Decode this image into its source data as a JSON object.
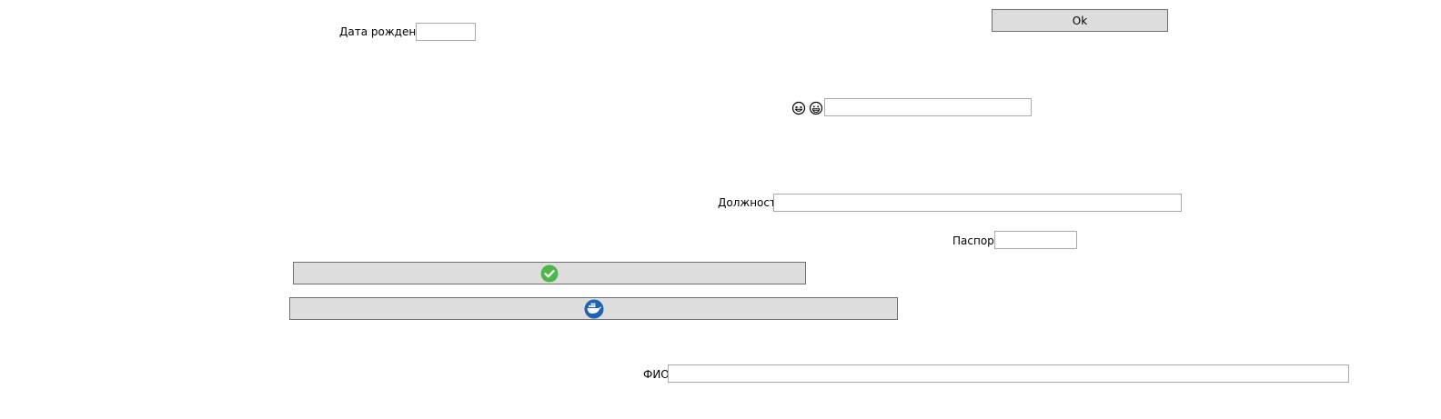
{
  "form": {
    "birth_date_label": "Дата рождения",
    "birth_date_value": "",
    "ok_button_label": "Ok",
    "emoji_field_value": "",
    "position_label": "Должность",
    "position_value": "",
    "passport_label": "Паспорт",
    "passport_value": "",
    "fio_label": "ФИО",
    "fio_value": ""
  },
  "icons": {
    "emoji_1": "laughing-face-icon",
    "emoji_2": "grinning-face-icon",
    "confirm": "check-circle-icon",
    "cloud": "docker-whale-icon"
  },
  "colors": {
    "button_bg": "#dddddd",
    "button_border": "#707070",
    "input_border": "#a9a9a9",
    "check_green": "#4cb648",
    "docker_blue": "#1d63b4"
  }
}
